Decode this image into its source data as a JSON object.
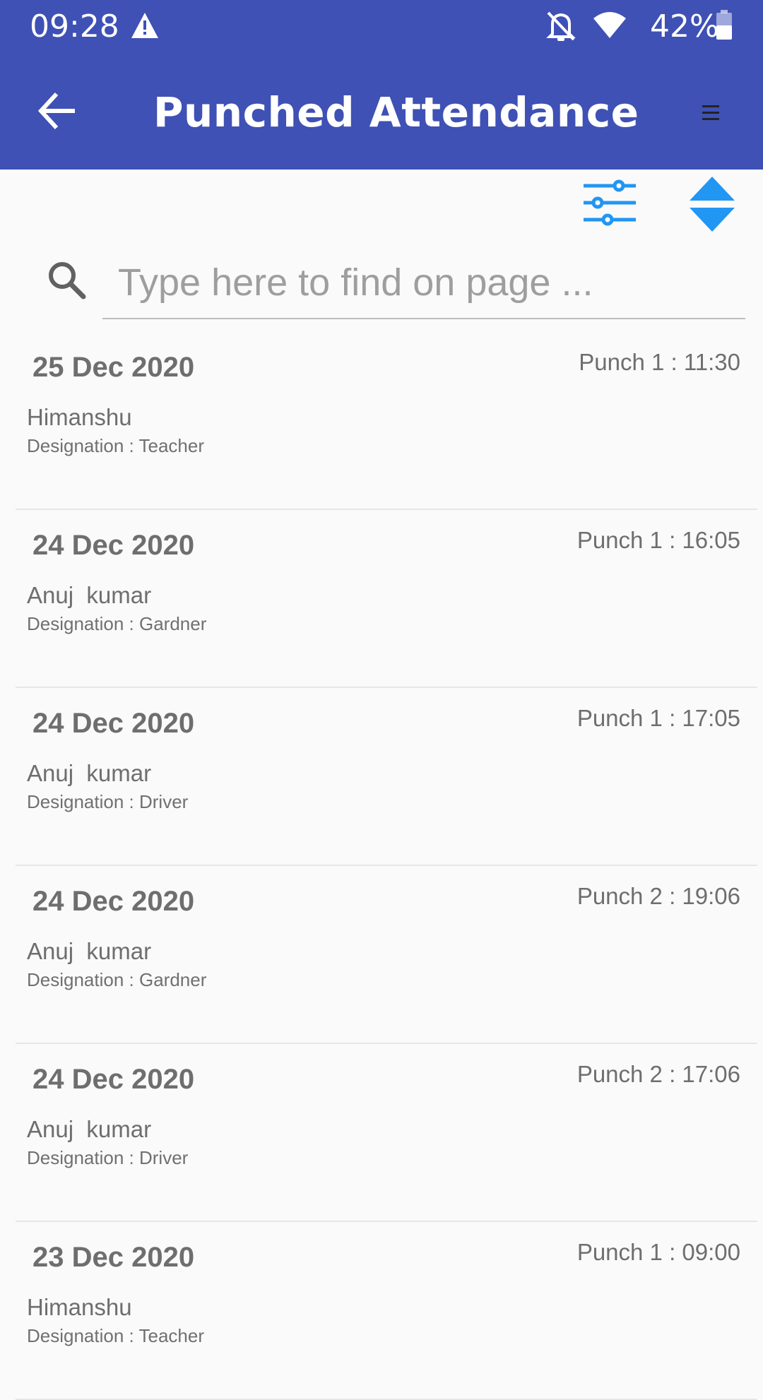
{
  "status_bar": {
    "time": "09:28",
    "battery": "42%",
    "icons": [
      "warning-icon",
      "notifications-off-icon",
      "wifi-icon",
      "battery-icon"
    ]
  },
  "app_bar": {
    "title": "Punched Attendance",
    "back_icon": "arrow-back-icon",
    "menu_icon": "menu-icon",
    "color": "#3f51b5"
  },
  "toolbar": {
    "filter_icon": "sliders-icon",
    "sort_icon": "sort-icon",
    "accent": "#2196f3"
  },
  "search": {
    "placeholder": "Type here to find on page ...",
    "value": ""
  },
  "records": [
    {
      "date": "25 Dec 2020",
      "punch": "Punch 1 : 11:30",
      "name": "Himanshu",
      "designation": "Designation : Teacher"
    },
    {
      "date": "24 Dec 2020",
      "punch": "Punch 1 : 16:05",
      "name": "Anuj  kumar",
      "designation": "Designation : Gardner"
    },
    {
      "date": "24 Dec 2020",
      "punch": "Punch 1 : 17:05",
      "name": "Anuj  kumar",
      "designation": "Designation : Driver"
    },
    {
      "date": "24 Dec 2020",
      "punch": "Punch 2 : 19:06",
      "name": "Anuj  kumar",
      "designation": "Designation : Gardner"
    },
    {
      "date": "24 Dec 2020",
      "punch": "Punch 2 : 17:06",
      "name": "Anuj  kumar",
      "designation": "Designation : Driver"
    },
    {
      "date": "23 Dec 2020",
      "punch": "Punch 1 : 09:00",
      "name": "Himanshu",
      "designation": "Designation : Teacher"
    }
  ]
}
